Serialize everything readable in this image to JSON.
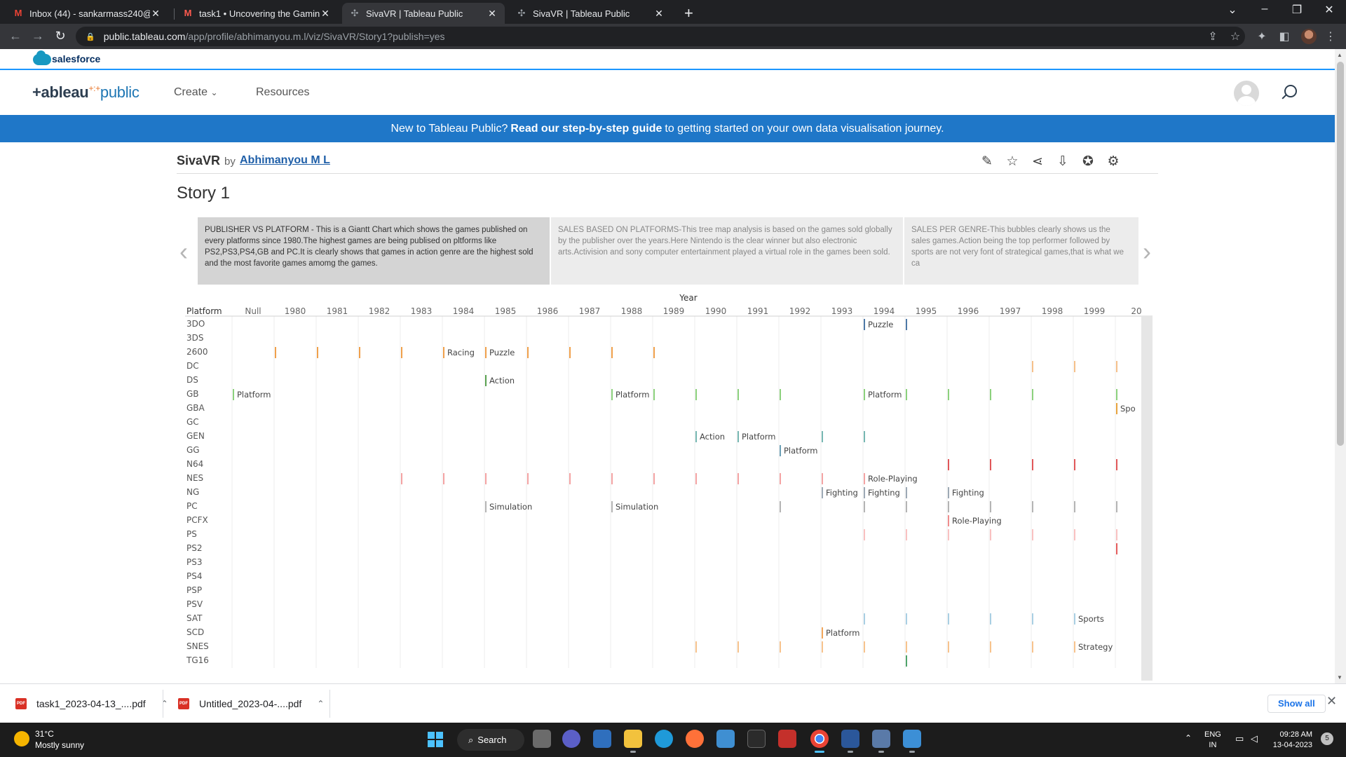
{
  "browser": {
    "tabs": [
      {
        "title": "Inbox (44) - sankarmass240@gm",
        "icon": "gmail-icon",
        "active": false
      },
      {
        "title": "task1 • Uncovering the Gaming I",
        "icon": "miro-icon",
        "active": false
      },
      {
        "title": "SivaVR | Tableau Public",
        "icon": "tableau-icon",
        "active": true
      },
      {
        "title": "SivaVR | Tableau Public",
        "icon": "tableau-icon",
        "active": false
      }
    ],
    "url_host": "public.tableau.com",
    "url_path": "/app/profile/abhimanyou.m.l/viz/SivaVR/Story1?publish=yes"
  },
  "salesforce": {
    "label": "salesforce"
  },
  "tableau_header": {
    "logo_prefix": "+ableau",
    "logo_dots": "+:+",
    "logo_suffix": "public",
    "nav": {
      "create": "Create",
      "resources": "Resources"
    }
  },
  "banner": {
    "lead": "New to Tableau Public?",
    "bold": "Read our step-by-step guide",
    "tail": "to getting started on your own data visualisation journey."
  },
  "viz": {
    "name": "SivaVR",
    "by": "by",
    "author": "Abhimanyou M L",
    "story_title": "Story 1"
  },
  "story_points": [
    {
      "text": "PUBLISHER VS PLATFORM - This is a Giantt Chart which shows the games published on every platforms since 1980.The highest games are being publised on pltforms like PS2,PS3,PS4,GB and PC.It is clearly shows that games in action genre are the highest sold and the most favorite games amomg the games.",
      "active": true
    },
    {
      "text": "SALES BASED ON PLATFORMS-This tree map analysis is based on the games sold globally by the publisher over the years.Here Nintendo is the clear winner but also electronic arts.Activision and sony computer entertainment played a virtual role in the games been sold.",
      "active": false
    },
    {
      "text": "SALES PER GENRE-This bubbles clearly shows us the sales games.Action being the top performer followed by sports are not very font of strategical games,that is what we ca",
      "active": false
    }
  ],
  "chart_data": {
    "type": "gantt",
    "title": "",
    "column_header": "Year",
    "row_header": "Platform",
    "x": [
      "Null",
      "1980",
      "1981",
      "1982",
      "1983",
      "1984",
      "1985",
      "1986",
      "1987",
      "1988",
      "1989",
      "1990",
      "1991",
      "1992",
      "1993",
      "1994",
      "1995",
      "1996",
      "1997",
      "1998",
      "1999",
      "20"
    ],
    "y": [
      "3DO",
      "3DS",
      "2600",
      "DC",
      "DS",
      "GB",
      "GBA",
      "GC",
      "GEN",
      "GG",
      "N64",
      "NES",
      "NG",
      "PC",
      "PCFX",
      "PS",
      "PS2",
      "PS3",
      "PS4",
      "PSP",
      "PSV",
      "SAT",
      "SCD",
      "SNES",
      "TG16"
    ],
    "platform_colors": {
      "3DO": "#4e79a7",
      "2600": "#f0a04b",
      "DC": "#f5c08a",
      "DS": "#59a14f",
      "GB": "#8cd17d",
      "GBA": "#e8a33d",
      "GEN": "#76b7b2",
      "GG": "#6a9fb5",
      "N64": "#e15759",
      "NES": "#f4a3a3",
      "NG": "#9da9b5",
      "PC": "#b4b4b4",
      "PCFX": "#f08d8d",
      "PS": "#f9c1c1",
      "PS2": "#e55c5c",
      "SAT": "#a9cfe3",
      "SCD": "#f2a65a",
      "SNES": "#f7c38d",
      "TG16": "#4fa36a"
    },
    "marks": [
      {
        "platform": "3DO",
        "year": "1994",
        "label": "Puzzle"
      },
      {
        "platform": "3DO",
        "year": "1995",
        "label": ""
      },
      {
        "platform": "2600",
        "year": "1980",
        "label": ""
      },
      {
        "platform": "2600",
        "year": "1981",
        "label": ""
      },
      {
        "platform": "2600",
        "year": "1982",
        "label": ""
      },
      {
        "platform": "2600",
        "year": "1983",
        "label": ""
      },
      {
        "platform": "2600",
        "year": "1984",
        "label": "Racing"
      },
      {
        "platform": "2600",
        "year": "1985",
        "label": "Puzzle"
      },
      {
        "platform": "2600",
        "year": "1986",
        "label": ""
      },
      {
        "platform": "2600",
        "year": "1987",
        "label": ""
      },
      {
        "platform": "2600",
        "year": "1988",
        "label": ""
      },
      {
        "platform": "2600",
        "year": "1989",
        "label": ""
      },
      {
        "platform": "DC",
        "year": "1998",
        "label": ""
      },
      {
        "platform": "DC",
        "year": "1999",
        "label": ""
      },
      {
        "platform": "DC",
        "year": "20",
        "label": ""
      },
      {
        "platform": "DS",
        "year": "1985",
        "label": "Action"
      },
      {
        "platform": "GB",
        "year": "Null",
        "label": "Platform"
      },
      {
        "platform": "GB",
        "year": "1988",
        "label": "Platform"
      },
      {
        "platform": "GB",
        "year": "1989",
        "label": ""
      },
      {
        "platform": "GB",
        "year": "1990",
        "label": ""
      },
      {
        "platform": "GB",
        "year": "1991",
        "label": ""
      },
      {
        "platform": "GB",
        "year": "1992",
        "label": ""
      },
      {
        "platform": "GB",
        "year": "1994",
        "label": "Platform"
      },
      {
        "platform": "GB",
        "year": "1995",
        "label": ""
      },
      {
        "platform": "GB",
        "year": "1996",
        "label": ""
      },
      {
        "platform": "GB",
        "year": "1997",
        "label": ""
      },
      {
        "platform": "GB",
        "year": "1998",
        "label": ""
      },
      {
        "platform": "GB",
        "year": "20",
        "label": ""
      },
      {
        "platform": "GBA",
        "year": "20",
        "label": "Spo"
      },
      {
        "platform": "GEN",
        "year": "1990",
        "label": "Action"
      },
      {
        "platform": "GEN",
        "year": "1991",
        "label": "Platform"
      },
      {
        "platform": "GEN",
        "year": "1993",
        "label": ""
      },
      {
        "platform": "GEN",
        "year": "1994",
        "label": ""
      },
      {
        "platform": "GG",
        "year": "1992",
        "label": "Platform"
      },
      {
        "platform": "N64",
        "year": "1996",
        "label": ""
      },
      {
        "platform": "N64",
        "year": "1997",
        "label": ""
      },
      {
        "platform": "N64",
        "year": "1998",
        "label": ""
      },
      {
        "platform": "N64",
        "year": "1999",
        "label": ""
      },
      {
        "platform": "N64",
        "year": "20",
        "label": ""
      },
      {
        "platform": "NES",
        "year": "1983",
        "label": ""
      },
      {
        "platform": "NES",
        "year": "1984",
        "label": ""
      },
      {
        "platform": "NES",
        "year": "1985",
        "label": ""
      },
      {
        "platform": "NES",
        "year": "1986",
        "label": ""
      },
      {
        "platform": "NES",
        "year": "1987",
        "label": ""
      },
      {
        "platform": "NES",
        "year": "1988",
        "label": ""
      },
      {
        "platform": "NES",
        "year": "1989",
        "label": ""
      },
      {
        "platform": "NES",
        "year": "1990",
        "label": ""
      },
      {
        "platform": "NES",
        "year": "1991",
        "label": ""
      },
      {
        "platform": "NES",
        "year": "1992",
        "label": ""
      },
      {
        "platform": "NES",
        "year": "1993",
        "label": ""
      },
      {
        "platform": "NES",
        "year": "1994",
        "label": "Role-Playing"
      },
      {
        "platform": "NG",
        "year": "1993",
        "label": "Fighting"
      },
      {
        "platform": "NG",
        "year": "1994",
        "label": "Fighting"
      },
      {
        "platform": "NG",
        "year": "1995",
        "label": ""
      },
      {
        "platform": "NG",
        "year": "1996",
        "label": "Fighting"
      },
      {
        "platform": "PC",
        "year": "1985",
        "label": "Simulation"
      },
      {
        "platform": "PC",
        "year": "1988",
        "label": "Simulation"
      },
      {
        "platform": "PC",
        "year": "1992",
        "label": ""
      },
      {
        "platform": "PC",
        "year": "1994",
        "label": ""
      },
      {
        "platform": "PC",
        "year": "1995",
        "label": ""
      },
      {
        "platform": "PC",
        "year": "1996",
        "label": ""
      },
      {
        "platform": "PC",
        "year": "1997",
        "label": ""
      },
      {
        "platform": "PC",
        "year": "1998",
        "label": ""
      },
      {
        "platform": "PC",
        "year": "1999",
        "label": ""
      },
      {
        "platform": "PC",
        "year": "20",
        "label": ""
      },
      {
        "platform": "PCFX",
        "year": "1996",
        "label": "Role-Playing"
      },
      {
        "platform": "PS",
        "year": "1994",
        "label": ""
      },
      {
        "platform": "PS",
        "year": "1995",
        "label": ""
      },
      {
        "platform": "PS",
        "year": "1996",
        "label": ""
      },
      {
        "platform": "PS",
        "year": "1997",
        "label": ""
      },
      {
        "platform": "PS",
        "year": "1998",
        "label": ""
      },
      {
        "platform": "PS",
        "year": "1999",
        "label": ""
      },
      {
        "platform": "PS",
        "year": "20",
        "label": ""
      },
      {
        "platform": "PS2",
        "year": "20",
        "label": ""
      },
      {
        "platform": "SAT",
        "year": "1994",
        "label": ""
      },
      {
        "platform": "SAT",
        "year": "1995",
        "label": ""
      },
      {
        "platform": "SAT",
        "year": "1996",
        "label": ""
      },
      {
        "platform": "SAT",
        "year": "1997",
        "label": ""
      },
      {
        "platform": "SAT",
        "year": "1998",
        "label": ""
      },
      {
        "platform": "SAT",
        "year": "1999",
        "label": "Sports"
      },
      {
        "platform": "SCD",
        "year": "1993",
        "label": "Platform"
      },
      {
        "platform": "SNES",
        "year": "1990",
        "label": ""
      },
      {
        "platform": "SNES",
        "year": "1991",
        "label": ""
      },
      {
        "platform": "SNES",
        "year": "1992",
        "label": ""
      },
      {
        "platform": "SNES",
        "year": "1993",
        "label": ""
      },
      {
        "platform": "SNES",
        "year": "1994",
        "label": ""
      },
      {
        "platform": "SNES",
        "year": "1995",
        "label": ""
      },
      {
        "platform": "SNES",
        "year": "1996",
        "label": ""
      },
      {
        "platform": "SNES",
        "year": "1997",
        "label": ""
      },
      {
        "platform": "SNES",
        "year": "1998",
        "label": ""
      },
      {
        "platform": "SNES",
        "year": "1999",
        "label": "Strategy"
      },
      {
        "platform": "TG16",
        "year": "1995",
        "label": ""
      }
    ]
  },
  "downloads": {
    "items": [
      "task1_2023-04-13_....pdf",
      "Untitled_2023-04-....pdf"
    ],
    "pdf_badge": "PDF",
    "show_all": "Show all"
  },
  "taskbar": {
    "weather_temp": "31°C",
    "weather_desc": "Mostly sunny",
    "search_label": "Search",
    "lang_top": "ENG",
    "lang_bottom": "IN",
    "time": "09:28 AM",
    "date": "13-04-2023",
    "notification_count": "5"
  }
}
